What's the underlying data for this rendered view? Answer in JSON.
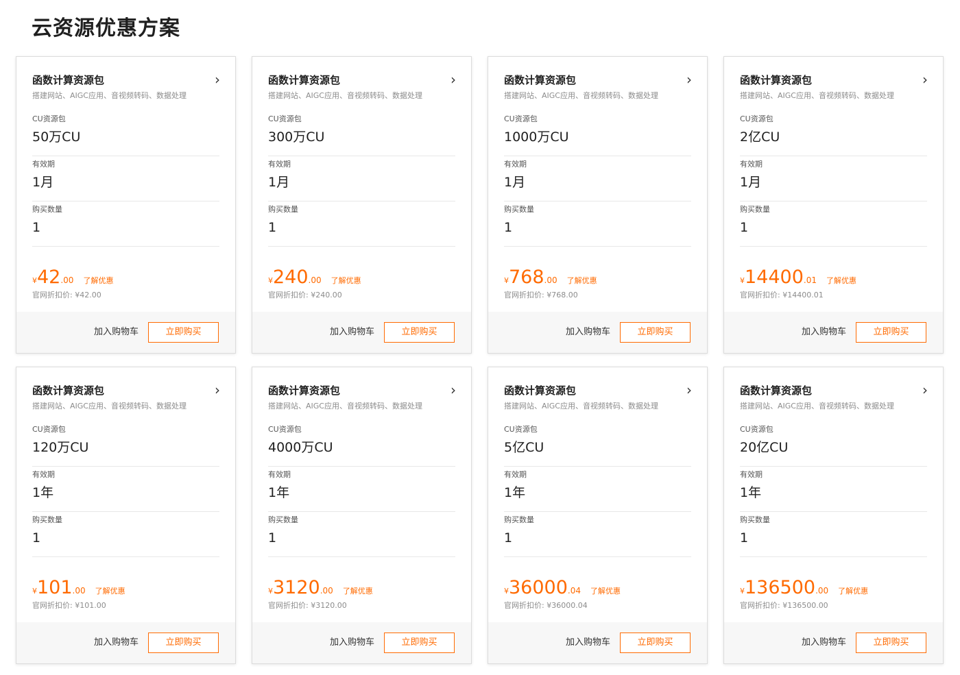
{
  "page": {
    "title": "云资源优惠方案"
  },
  "cards": [
    {
      "title": "函数计算资源包",
      "desc": "搭建网站、AIGC应用、音视频转码、数据处理",
      "spec_label": "CU资源包",
      "spec_value": "50万CU",
      "period_label": "有效期",
      "period_value": "1月",
      "qty_label": "购买数量",
      "qty_value": "1",
      "currency": "¥",
      "price_int": "42",
      "price_dec": ".00",
      "discount_link": "了解优惠",
      "orig_price": "官网折扣价: ¥42.00",
      "cart_label": "加入购物车",
      "buy_label": "立即购买"
    },
    {
      "title": "函数计算资源包",
      "desc": "搭建网站、AIGC应用、音视频转码、数据处理",
      "spec_label": "CU资源包",
      "spec_value": "300万CU",
      "period_label": "有效期",
      "period_value": "1月",
      "qty_label": "购买数量",
      "qty_value": "1",
      "currency": "¥",
      "price_int": "240",
      "price_dec": ".00",
      "discount_link": "了解优惠",
      "orig_price": "官网折扣价: ¥240.00",
      "cart_label": "加入购物车",
      "buy_label": "立即购买"
    },
    {
      "title": "函数计算资源包",
      "desc": "搭建网站、AIGC应用、音视频转码、数据处理",
      "spec_label": "CU资源包",
      "spec_value": "1000万CU",
      "period_label": "有效期",
      "period_value": "1月",
      "qty_label": "购买数量",
      "qty_value": "1",
      "currency": "¥",
      "price_int": "768",
      "price_dec": ".00",
      "discount_link": "了解优惠",
      "orig_price": "官网折扣价: ¥768.00",
      "cart_label": "加入购物车",
      "buy_label": "立即购买"
    },
    {
      "title": "函数计算资源包",
      "desc": "搭建网站、AIGC应用、音视频转码、数据处理",
      "spec_label": "CU资源包",
      "spec_value": "2亿CU",
      "period_label": "有效期",
      "period_value": "1月",
      "qty_label": "购买数量",
      "qty_value": "1",
      "currency": "¥",
      "price_int": "14400",
      "price_dec": ".01",
      "discount_link": "了解优惠",
      "orig_price": "官网折扣价: ¥14400.01",
      "cart_label": "加入购物车",
      "buy_label": "立即购买"
    },
    {
      "title": "函数计算资源包",
      "desc": "搭建网站、AIGC应用、音视频转码、数据处理",
      "spec_label": "CU资源包",
      "spec_value": "120万CU",
      "period_label": "有效期",
      "period_value": "1年",
      "qty_label": "购买数量",
      "qty_value": "1",
      "currency": "¥",
      "price_int": "101",
      "price_dec": ".00",
      "discount_link": "了解优惠",
      "orig_price": "官网折扣价: ¥101.00",
      "cart_label": "加入购物车",
      "buy_label": "立即购买"
    },
    {
      "title": "函数计算资源包",
      "desc": "搭建网站、AIGC应用、音视频转码、数据处理",
      "spec_label": "CU资源包",
      "spec_value": "4000万CU",
      "period_label": "有效期",
      "period_value": "1年",
      "qty_label": "购买数量",
      "qty_value": "1",
      "currency": "¥",
      "price_int": "3120",
      "price_dec": ".00",
      "discount_link": "了解优惠",
      "orig_price": "官网折扣价: ¥3120.00",
      "cart_label": "加入购物车",
      "buy_label": "立即购买"
    },
    {
      "title": "函数计算资源包",
      "desc": "搭建网站、AIGC应用、音视频转码、数据处理",
      "spec_label": "CU资源包",
      "spec_value": "5亿CU",
      "period_label": "有效期",
      "period_value": "1年",
      "qty_label": "购买数量",
      "qty_value": "1",
      "currency": "¥",
      "price_int": "36000",
      "price_dec": ".04",
      "discount_link": "了解优惠",
      "orig_price": "官网折扣价: ¥36000.04",
      "cart_label": "加入购物车",
      "buy_label": "立即购买"
    },
    {
      "title": "函数计算资源包",
      "desc": "搭建网站、AIGC应用、音视频转码、数据处理",
      "spec_label": "CU资源包",
      "spec_value": "20亿CU",
      "period_label": "有效期",
      "period_value": "1年",
      "qty_label": "购买数量",
      "qty_value": "1",
      "currency": "¥",
      "price_int": "136500",
      "price_dec": ".00",
      "discount_link": "了解优惠",
      "orig_price": "官网折扣价: ¥136500.00",
      "cart_label": "加入购物车",
      "buy_label": "立即购买"
    }
  ],
  "icons": {
    "card_arrow": "chevron-right-icon"
  },
  "colors": {
    "accent": "#ff6a00",
    "footer_bg": "#f7f7f7",
    "border": "#dcdcdc"
  }
}
